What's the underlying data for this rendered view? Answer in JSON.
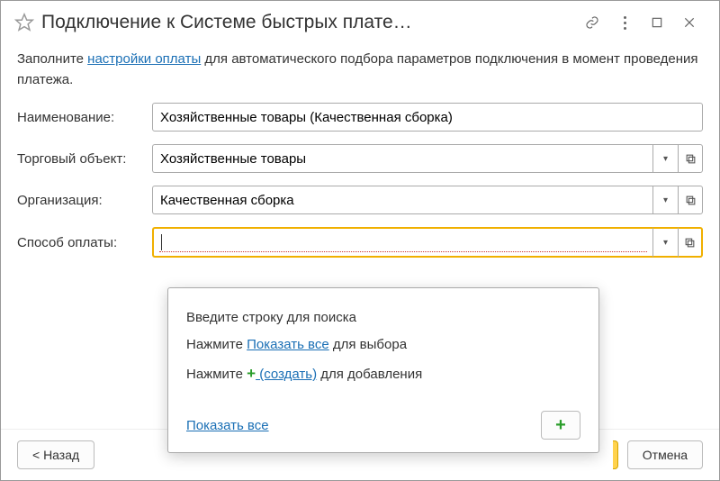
{
  "title": "Подключение к Системе быстрых плате…",
  "intro": {
    "pre": "Заполните ",
    "link": "настройки оплаты",
    "post": " для автоматического подбора параметров подключения в момент проведения платежа."
  },
  "fields": {
    "name_label": "Наименование:",
    "name_value": "Хозяйственные товары (Качественная сборка)",
    "object_label": "Торговый объект:",
    "object_value": "Хозяйственные товары",
    "org_label": "Организация:",
    "org_value": "Качественная сборка",
    "paymethod_label": "Способ оплаты:",
    "paymethod_value": ""
  },
  "popup": {
    "line1": "Введите строку для поиска",
    "line2_pre": "Нажмите ",
    "line2_link": "Показать все",
    "line2_post": " для выбора",
    "line3_pre": "Нажмите ",
    "line3_link": " (создать)",
    "line3_post": " для добавления",
    "show_all": "Показать все"
  },
  "footer": {
    "back": "< Назад",
    "cancel": "Отмена"
  }
}
